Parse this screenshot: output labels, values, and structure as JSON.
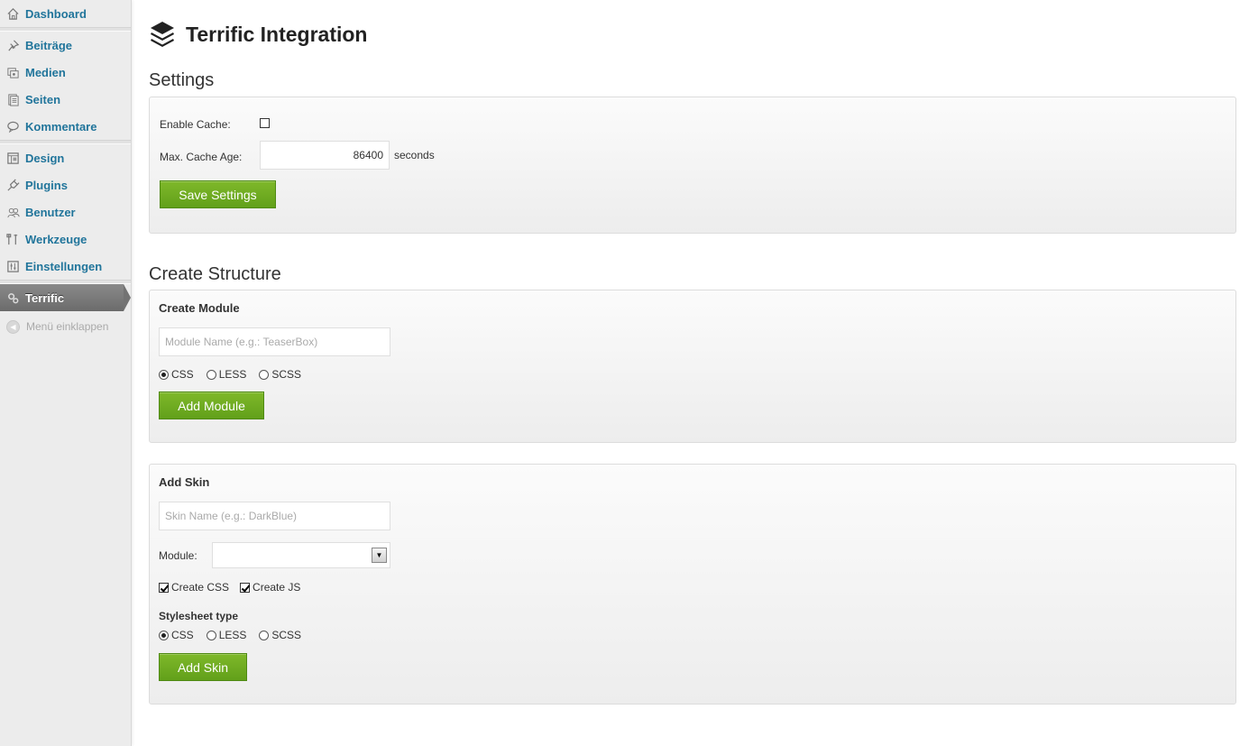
{
  "sidebar": {
    "items": [
      {
        "label": "Dashboard",
        "icon": "home-icon"
      },
      {
        "label": "Beiträge",
        "icon": "pin-icon"
      },
      {
        "label": "Medien",
        "icon": "media-icon"
      },
      {
        "label": "Seiten",
        "icon": "pages-icon"
      },
      {
        "label": "Kommentare",
        "icon": "comment-icon"
      },
      {
        "label": "Design",
        "icon": "design-icon"
      },
      {
        "label": "Plugins",
        "icon": "plug-icon"
      },
      {
        "label": "Benutzer",
        "icon": "users-icon"
      },
      {
        "label": "Werkzeuge",
        "icon": "tools-icon"
      },
      {
        "label": "Einstellungen",
        "icon": "settings-icon"
      },
      {
        "label": "Terrific",
        "icon": "gears-icon",
        "active": true
      }
    ],
    "collapse_label": "Menü einklappen"
  },
  "page": {
    "title": "Terrific Integration"
  },
  "settings": {
    "heading": "Settings",
    "enable_cache_label": "Enable Cache:",
    "enable_cache_checked": false,
    "max_cache_age_label": "Max. Cache Age:",
    "max_cache_age_value": "86400",
    "max_cache_age_unit": "seconds",
    "save_button": "Save Settings"
  },
  "structure": {
    "heading": "Create Structure",
    "create_module": {
      "title": "Create Module",
      "name_placeholder": "Module Name (e.g.: TeaserBox)",
      "style_options": [
        "CSS",
        "LESS",
        "SCSS"
      ],
      "selected_style": "CSS",
      "button": "Add Module"
    },
    "add_skin": {
      "title": "Add Skin",
      "name_placeholder": "Skin Name (e.g.: DarkBlue)",
      "module_label": "Module:",
      "module_value": "",
      "create_css_label": "Create CSS",
      "create_css_checked": true,
      "create_js_label": "Create JS",
      "create_js_checked": true,
      "stylesheet_type_label": "Stylesheet type",
      "style_options": [
        "CSS",
        "LESS",
        "SCSS"
      ],
      "selected_style": "CSS",
      "button": "Add Skin"
    }
  },
  "colors": {
    "link": "#21759b",
    "button_green": "#6aa820"
  }
}
